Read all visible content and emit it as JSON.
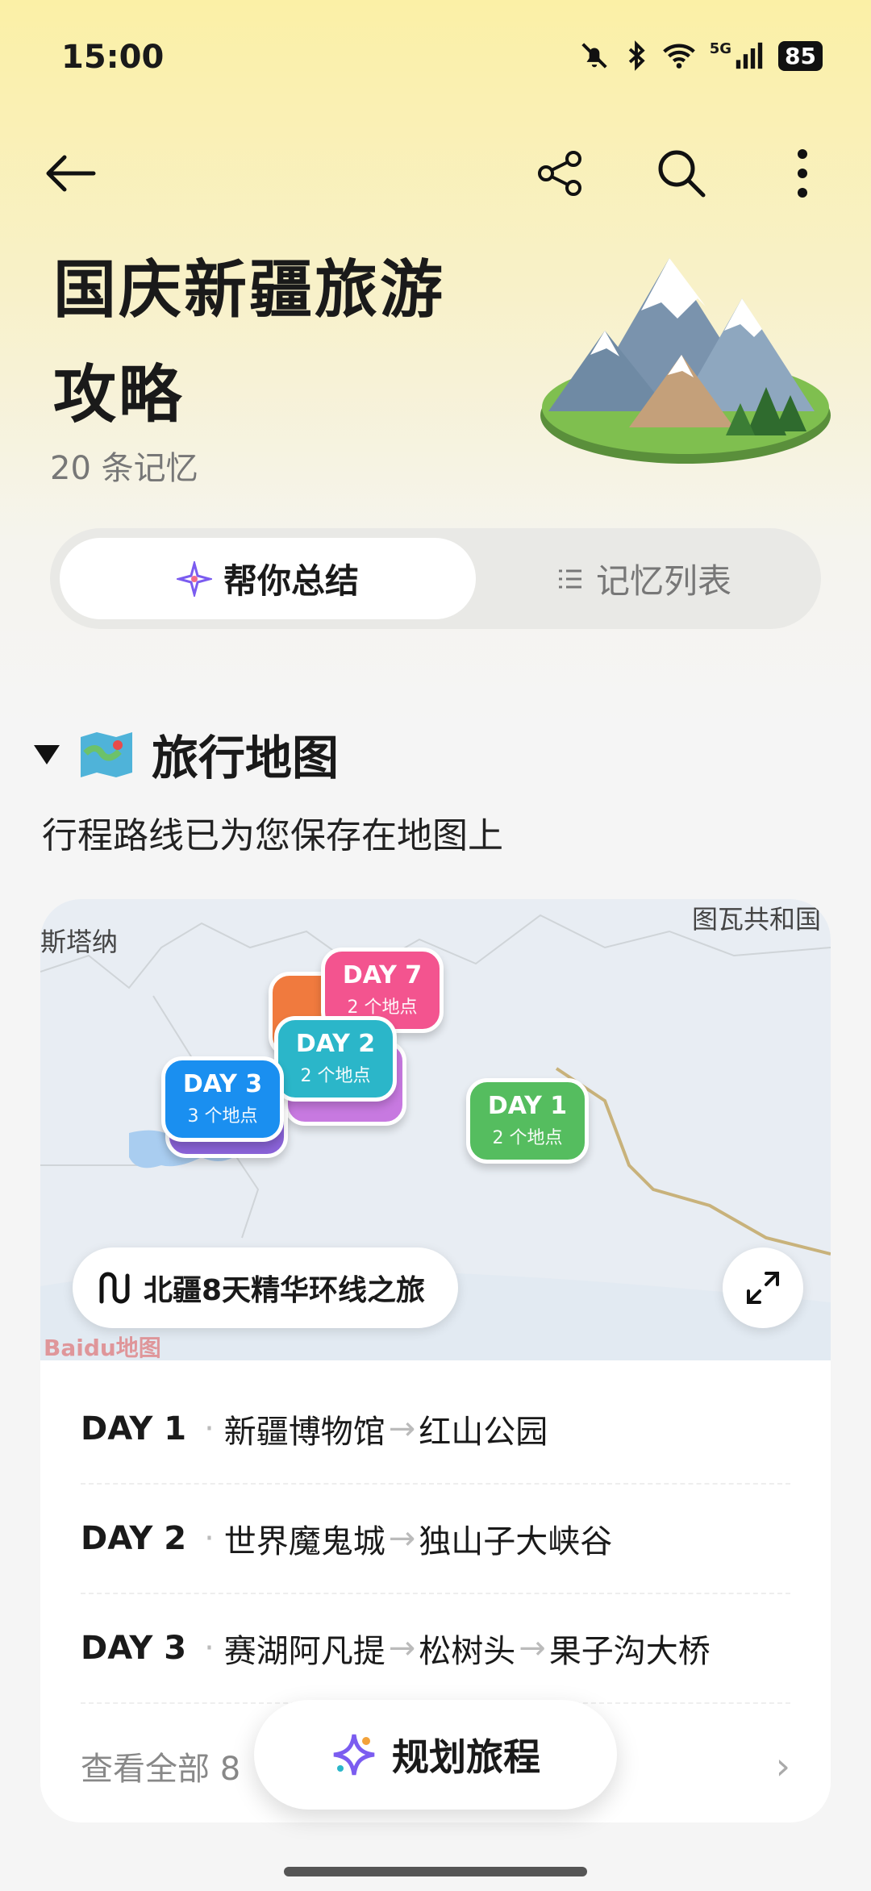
{
  "status_bar": {
    "time": "15:00",
    "network": "5G",
    "battery": "85"
  },
  "header": {
    "title": "国庆新疆旅游攻略",
    "memory_count": "20 条记忆"
  },
  "tabs": [
    {
      "label": "帮你总结",
      "active": true
    },
    {
      "label": "记忆列表",
      "active": false
    }
  ],
  "section": {
    "title": "旅行地图",
    "subtitle": "行程路线已为您保存在地图上"
  },
  "map": {
    "labels": {
      "left": "斯塔纳",
      "right": "图瓦共和国"
    },
    "pins": [
      {
        "day": "DAY 7",
        "places": "2 个地点",
        "color": "#f3548f"
      },
      {
        "day": "DAY 2",
        "places": "2 个地点",
        "color": "#2bb6c9"
      },
      {
        "day": "DAY 3",
        "places": "3 个地点",
        "color": "#1a8ff0"
      },
      {
        "day": "DAY 1",
        "places": "2 个地点",
        "color": "#55bd5f"
      }
    ],
    "route_name": "北疆8天精华环线之旅",
    "watermark": "Baidu地图"
  },
  "itinerary": [
    {
      "day": "DAY 1",
      "stops": [
        "新疆博物馆",
        "红山公园"
      ]
    },
    {
      "day": "DAY 2",
      "stops": [
        "世界魔鬼城",
        "独山子大峡谷"
      ]
    },
    {
      "day": "DAY 3",
      "stops": [
        "赛湖阿凡提",
        "松树头",
        "果子沟大桥"
      ]
    }
  ],
  "view_all": "查看全部 8",
  "plan_button": "规划旅程"
}
